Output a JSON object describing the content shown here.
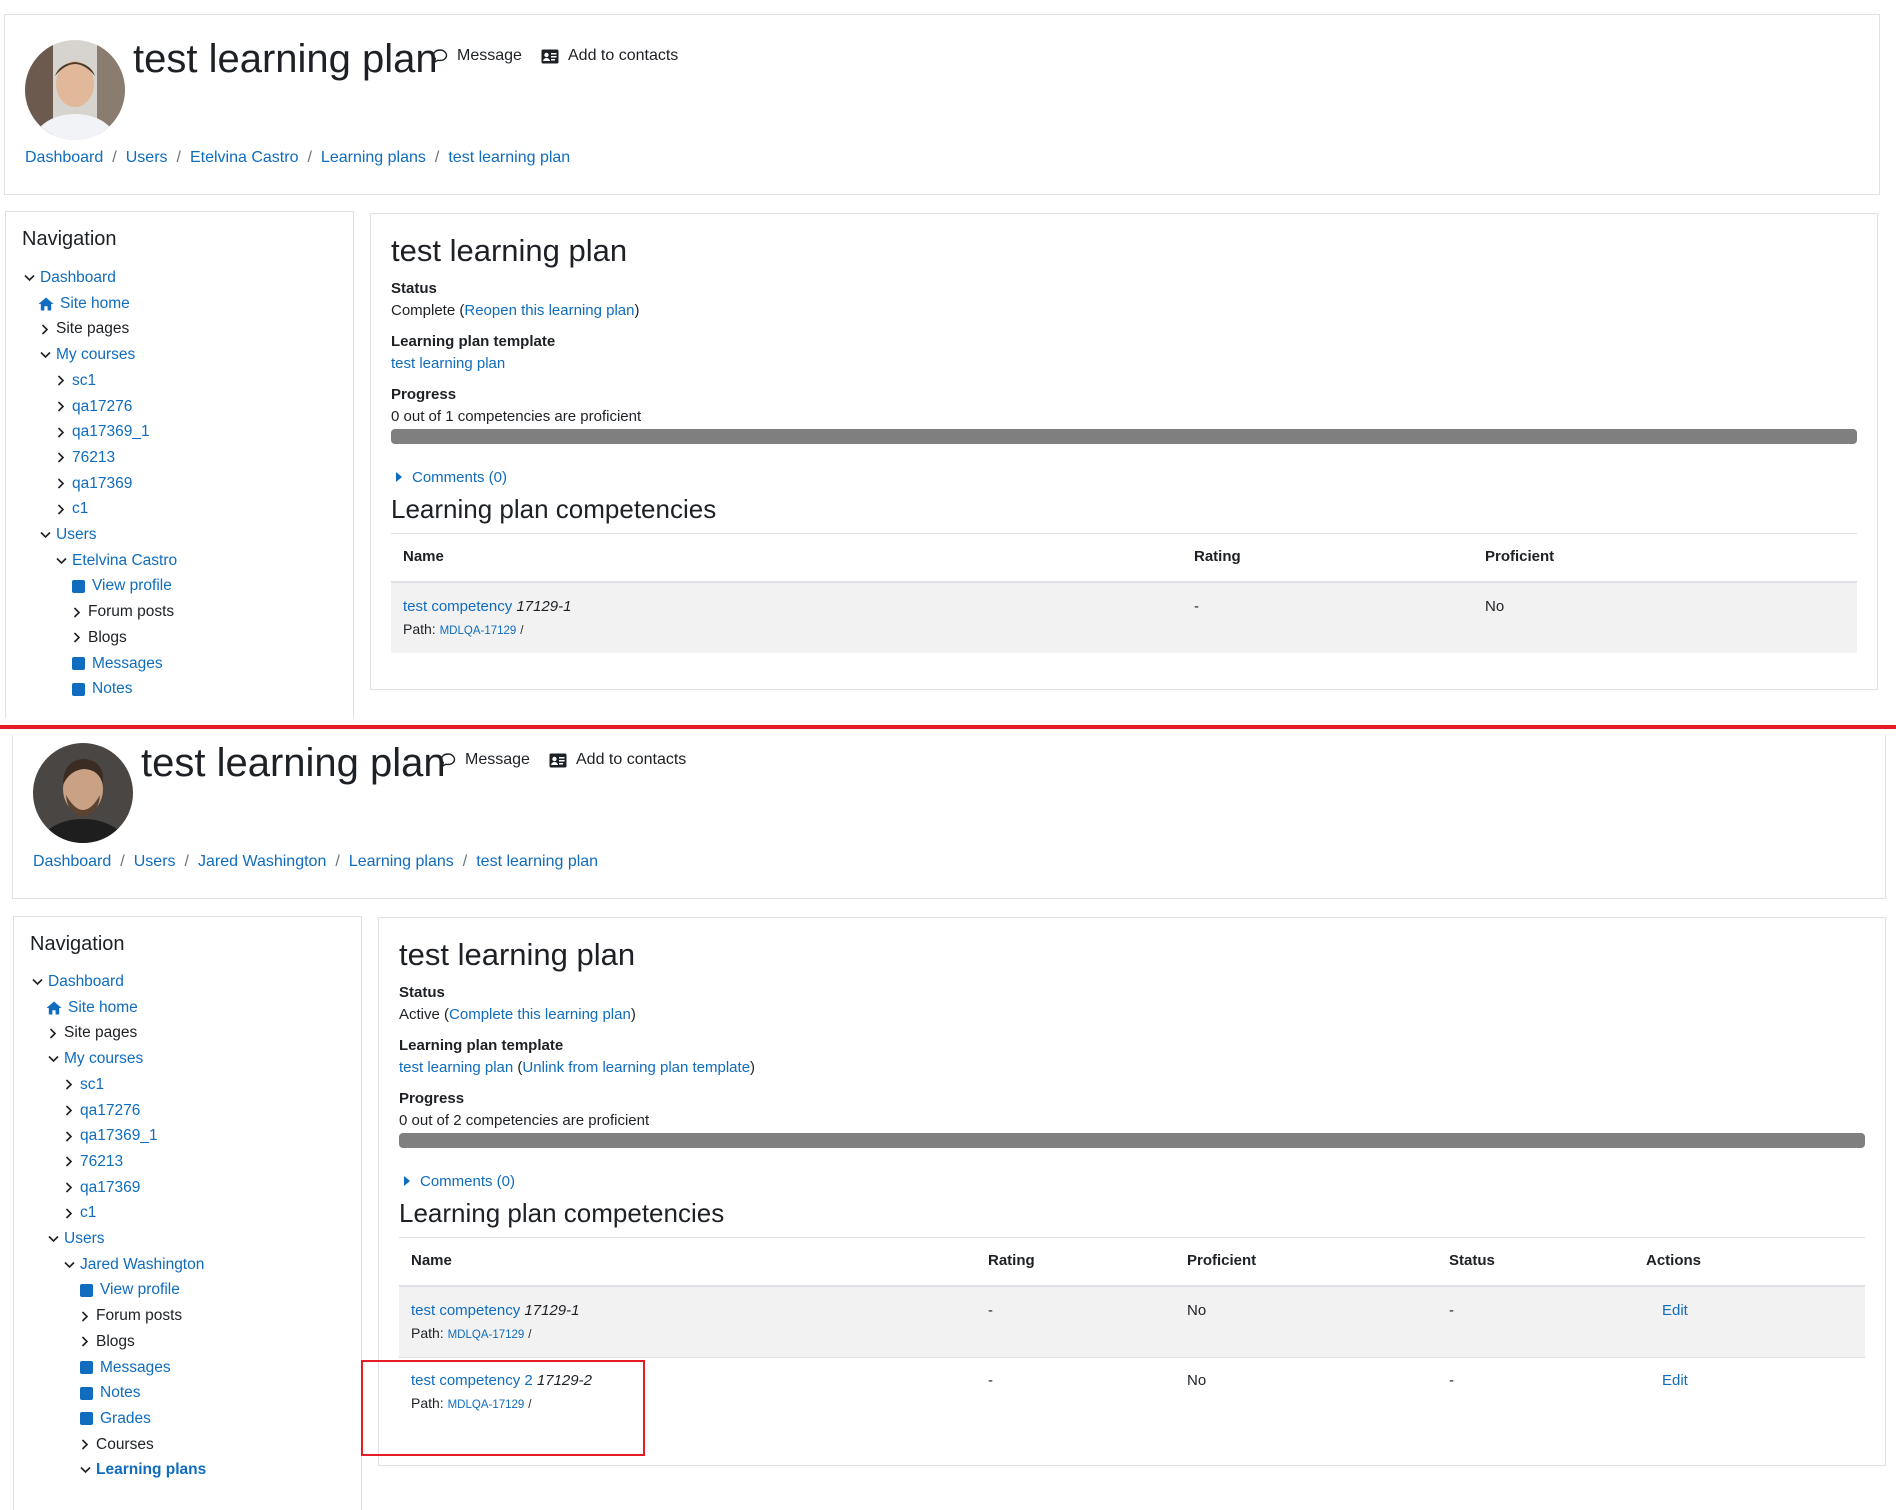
{
  "panels": [
    {
      "header": {
        "title": "test learning plan",
        "message_label": "Message",
        "add_contacts_label": "Add to contacts",
        "breadcrumbs": [
          "Dashboard",
          "Users",
          "Etelvina Castro",
          "Learning plans",
          "test learning plan"
        ]
      },
      "nav": {
        "title": "Navigation",
        "items": [
          {
            "label": "Dashboard",
            "type": "expanded",
            "link": true
          },
          {
            "label": "Site home",
            "type": "home",
            "link": true
          },
          {
            "label": "Site pages",
            "type": "collapsed",
            "link": false
          },
          {
            "label": "My courses",
            "type": "expanded",
            "link": true
          },
          {
            "label": "sc1",
            "type": "collapsed",
            "link": true
          },
          {
            "label": "qa17276",
            "type": "collapsed",
            "link": true
          },
          {
            "label": "qa17369_1",
            "type": "collapsed",
            "link": true
          },
          {
            "label": "76213",
            "type": "collapsed",
            "link": true
          },
          {
            "label": "qa17369",
            "type": "collapsed",
            "link": true
          },
          {
            "label": "c1",
            "type": "collapsed",
            "link": true
          },
          {
            "label": "Users",
            "type": "expanded",
            "link": true
          },
          {
            "label": "Etelvina Castro",
            "type": "expanded",
            "link": true
          },
          {
            "label": "View profile",
            "type": "square",
            "link": true
          },
          {
            "label": "Forum posts",
            "type": "collapsed",
            "link": false
          },
          {
            "label": "Blogs",
            "type": "collapsed",
            "link": false
          },
          {
            "label": "Messages",
            "type": "square",
            "link": true
          },
          {
            "label": "Notes",
            "type": "square",
            "link": true
          }
        ]
      },
      "main": {
        "title": "test learning plan",
        "status_label": "Status",
        "status_value": "Complete",
        "status_action": "Reopen this learning plan",
        "template_label": "Learning plan template",
        "template_link": "test learning plan",
        "template_action": "",
        "progress_label": "Progress",
        "progress_text": "0 out of 1 competencies are proficient",
        "progress_fraction": 0,
        "comments_label": "Comments (0)",
        "competencies_title": "Learning plan competencies",
        "columns": [
          "Name",
          "Rating",
          "Proficient"
        ],
        "rows": [
          {
            "name": "test competency",
            "idnumber": "17129-1",
            "path_label": "Path:",
            "path_link": "MDLQA-17129",
            "path_suffix": "/",
            "rating": "-",
            "proficient": "No"
          }
        ]
      }
    },
    {
      "header": {
        "title": "test learning plan",
        "message_label": "Message",
        "add_contacts_label": "Add to contacts",
        "breadcrumbs": [
          "Dashboard",
          "Users",
          "Jared Washington",
          "Learning plans",
          "test learning plan"
        ]
      },
      "nav": {
        "title": "Navigation",
        "items": [
          {
            "label": "Dashboard",
            "type": "expanded",
            "link": true
          },
          {
            "label": "Site home",
            "type": "home",
            "link": true
          },
          {
            "label": "Site pages",
            "type": "collapsed",
            "link": false
          },
          {
            "label": "My courses",
            "type": "expanded",
            "link": true
          },
          {
            "label": "sc1",
            "type": "collapsed",
            "link": true
          },
          {
            "label": "qa17276",
            "type": "collapsed",
            "link": true
          },
          {
            "label": "qa17369_1",
            "type": "collapsed",
            "link": true
          },
          {
            "label": "76213",
            "type": "collapsed",
            "link": true
          },
          {
            "label": "qa17369",
            "type": "collapsed",
            "link": true
          },
          {
            "label": "c1",
            "type": "collapsed",
            "link": true
          },
          {
            "label": "Users",
            "type": "expanded",
            "link": true
          },
          {
            "label": "Jared Washington",
            "type": "expanded",
            "link": true
          },
          {
            "label": "View profile",
            "type": "square",
            "link": true
          },
          {
            "label": "Forum posts",
            "type": "collapsed",
            "link": false
          },
          {
            "label": "Blogs",
            "type": "collapsed",
            "link": false
          },
          {
            "label": "Messages",
            "type": "square",
            "link": true
          },
          {
            "label": "Notes",
            "type": "square",
            "link": true
          },
          {
            "label": "Grades",
            "type": "square",
            "link": true
          },
          {
            "label": "Courses",
            "type": "collapsed",
            "link": false
          },
          {
            "label": "Learning plans",
            "type": "expanded",
            "link": true,
            "bold": true
          }
        ]
      },
      "main": {
        "title": "test learning plan",
        "status_label": "Status",
        "status_value": "Active",
        "status_action": "Complete this learning plan",
        "template_label": "Learning plan template",
        "template_link": "test learning plan",
        "template_action": "Unlink from learning plan template",
        "progress_label": "Progress",
        "progress_text": "0 out of 2 competencies are proficient",
        "progress_fraction": 0,
        "comments_label": "Comments (0)",
        "competencies_title": "Learning plan competencies",
        "columns": [
          "Name",
          "Rating",
          "Proficient",
          "Status",
          "Actions"
        ],
        "rows": [
          {
            "name": "test competency",
            "idnumber": "17129-1",
            "path_label": "Path:",
            "path_link": "MDLQA-17129",
            "path_suffix": "/",
            "rating": "-",
            "proficient": "No",
            "status": "-",
            "action": "Edit"
          },
          {
            "name": "test competency 2",
            "idnumber": "17129-2",
            "path_label": "Path:",
            "path_link": "MDLQA-17129",
            "path_suffix": "/",
            "rating": "-",
            "proficient": "No",
            "status": "-",
            "action": "Edit"
          }
        ]
      }
    }
  ],
  "colors": {
    "link": "#0f6cbf",
    "text": "#1d2125",
    "progress_track": "#7f7f7f",
    "annotation": "#e31d23",
    "row_stripe": "#f2f2f2"
  },
  "icons": [
    "message-icon",
    "contact-card-icon",
    "home-icon",
    "chevron-down-icon",
    "chevron-right-icon",
    "caret-right-icon"
  ]
}
